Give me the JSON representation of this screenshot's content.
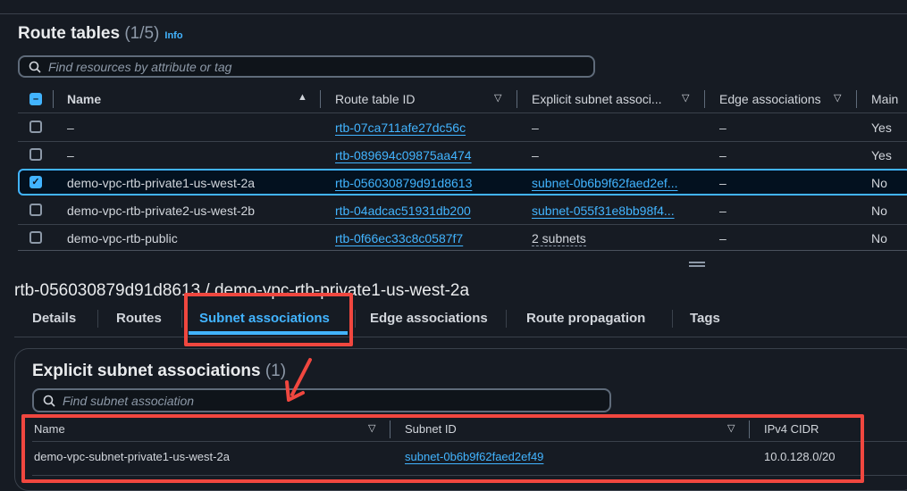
{
  "route_tables": {
    "title": "Route tables",
    "count": "(1/5)",
    "info_label": "Info",
    "search_placeholder": "Find resources by attribute or tag",
    "columns": [
      "Name",
      "Route table ID",
      "Explicit subnet associ...",
      "Edge associations",
      "Main"
    ],
    "rows": [
      {
        "name": "–",
        "id": "rtb-07ca711afe27dc56c",
        "subnet": "–",
        "edge": "–",
        "main": "Yes",
        "selected": false
      },
      {
        "name": "–",
        "id": "rtb-089694c09875aa474",
        "subnet": "–",
        "edge": "–",
        "main": "Yes",
        "selected": false
      },
      {
        "name": "demo-vpc-rtb-private1-us-west-2a",
        "id": "rtb-056030879d91d8613",
        "subnet": "subnet-0b6b9f62faed2ef...",
        "edge": "–",
        "main": "No",
        "selected": true
      },
      {
        "name": "demo-vpc-rtb-private2-us-west-2b",
        "id": "rtb-04adcac51931db200",
        "subnet": "subnet-055f31e8bb98f4...",
        "edge": "–",
        "main": "No",
        "selected": false
      },
      {
        "name": "demo-vpc-rtb-public",
        "id": "rtb-0f66ec33c8c0587f7",
        "subnet": "2 subnets",
        "edge": "–",
        "main": "No",
        "selected": false
      }
    ]
  },
  "detail": {
    "title": "rtb-056030879d91d8613 / demo-vpc-rtb-private1-us-west-2a",
    "tabs": [
      "Details",
      "Routes",
      "Subnet associations",
      "Edge associations",
      "Route propagation",
      "Tags"
    ],
    "active_tab": "Subnet associations",
    "panel": {
      "title": "Explicit subnet associations",
      "count": "(1)",
      "search_placeholder": "Find subnet association",
      "columns": [
        "Name",
        "Subnet ID",
        "IPv4 CIDR"
      ],
      "rows": [
        {
          "name": "demo-vpc-subnet-private1-us-west-2a",
          "subnet_id": "subnet-0b6b9f62faed2ef49",
          "cidr": "10.0.128.0/20"
        }
      ]
    }
  },
  "colors": {
    "accent": "#42b4ff",
    "annotation": "#f0473f",
    "background": "#161b23"
  }
}
